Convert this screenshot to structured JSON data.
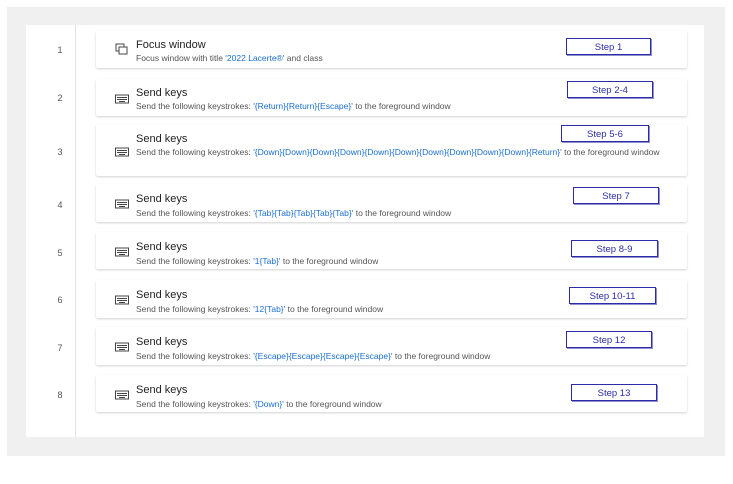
{
  "actions": [
    {
      "line": "1",
      "icon": "focus-window-icon",
      "title": "Focus window",
      "desc_pre": "Focus window with title ",
      "desc_hl": "'2022 Lacerte®'",
      "desc_post": " and class",
      "step": "Step 1"
    },
    {
      "line": "2",
      "icon": "keyboard-icon",
      "title": "Send keys",
      "desc_pre": "Send the following keystrokes: ",
      "desc_hl": "'{Return}{Return}{Escape}'",
      "desc_post": " to the foreground window",
      "step": "Step 2-4"
    },
    {
      "line": "3",
      "icon": "keyboard-icon",
      "title": "Send keys",
      "desc_pre": "Send the following keystrokes: ",
      "desc_hl": "'{Down}{Down}{Down}{Down}{Down}{Down}{Down}{Down}{Down}{Down}{Return}'",
      "desc_post": " to the foreground window",
      "step": "Step 5-6"
    },
    {
      "line": "4",
      "icon": "keyboard-icon",
      "title": "Send keys",
      "desc_pre": "Send the following keystrokes: ",
      "desc_hl": "'{Tab}{Tab}{Tab}{Tab}{Tab}'",
      "desc_post": " to the foreground window",
      "step": "Step 7"
    },
    {
      "line": "5",
      "icon": "keyboard-icon",
      "title": "Send keys",
      "desc_pre": "Send the following keystrokes: ",
      "desc_hl": "'1{Tab}'",
      "desc_post": " to the foreground window",
      "step": "Step 8-9"
    },
    {
      "line": "6",
      "icon": "keyboard-icon",
      "title": "Send keys",
      "desc_pre": "Send the following keystrokes: ",
      "desc_hl": "'12{Tab}'",
      "desc_post": " to the foreground window",
      "step": "Step 10-11"
    },
    {
      "line": "7",
      "icon": "keyboard-icon",
      "title": "Send keys",
      "desc_pre": "Send the following keystrokes: ",
      "desc_hl": "'{Escape}{Escape}{Escape}{Escape}'",
      "desc_post": " to the foreground window",
      "step": "Step 12"
    },
    {
      "line": "8",
      "icon": "keyboard-icon",
      "title": "Send keys",
      "desc_pre": "Send the following keystrokes: ",
      "desc_hl": "'{Down}'",
      "desc_post": " to the foreground window",
      "step": "Step 13"
    }
  ],
  "colors": {
    "highlight": "#1a6fd1",
    "step_border": "#2c2ca8"
  }
}
